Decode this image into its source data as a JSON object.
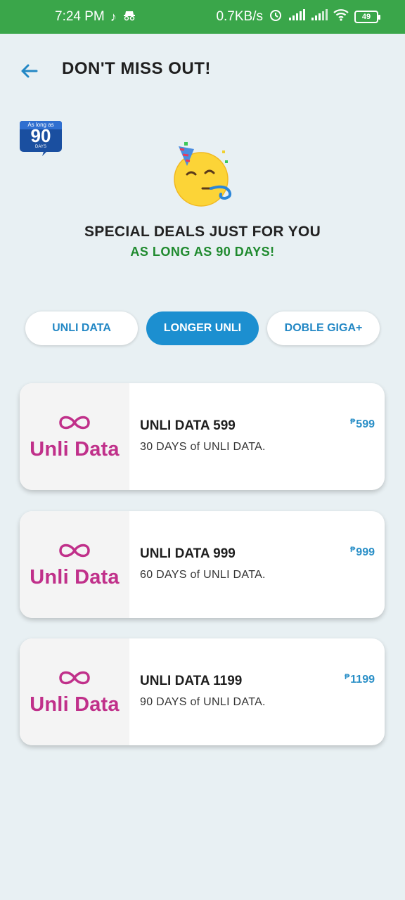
{
  "status_bar": {
    "time": "7:24 PM",
    "speed": "0.7KB/s",
    "battery": "49",
    "icons": [
      "tiktok-icon",
      "incognito-icon",
      "alarm-icon",
      "signal-icon",
      "signal-icon-2",
      "wifi-icon",
      "battery-icon"
    ]
  },
  "header": {
    "title": "DON'T MISS OUT!",
    "back_icon": "arrow-left-icon"
  },
  "badge": {
    "top": "As long as",
    "number": "90",
    "bottom": "DAYS"
  },
  "hero": {
    "emoji": "party-face-emoji",
    "title": "SPECIAL DEALS JUST FOR YOU",
    "subtitle": "AS LONG AS 90 DAYS!"
  },
  "tabs": [
    {
      "label": "UNLI DATA",
      "active": false
    },
    {
      "label": "LONGER UNLI",
      "active": true
    },
    {
      "label": "DOBLE GIGA+",
      "active": false
    }
  ],
  "plans": [
    {
      "logo_text": "Unli Data",
      "name": "UNLI DATA 599",
      "desc": "30 DAYS of UNLI DATA.",
      "currency": "₱",
      "price": "599"
    },
    {
      "logo_text": "Unli Data",
      "name": "UNLI DATA 999",
      "desc": "60 DAYS of UNLI DATA.",
      "currency": "₱",
      "price": "999"
    },
    {
      "logo_text": "Unli Data",
      "name": "UNLI DATA 1199",
      "desc": "90 DAYS of UNLI DATA.",
      "currency": "₱",
      "price": "1199"
    }
  ],
  "colors": {
    "status_green": "#3aa64a",
    "accent_blue": "#1c8fd0",
    "subtitle_green": "#1f8a2e",
    "logo_magenta": "#c0308a",
    "background": "#e8f0f3"
  }
}
